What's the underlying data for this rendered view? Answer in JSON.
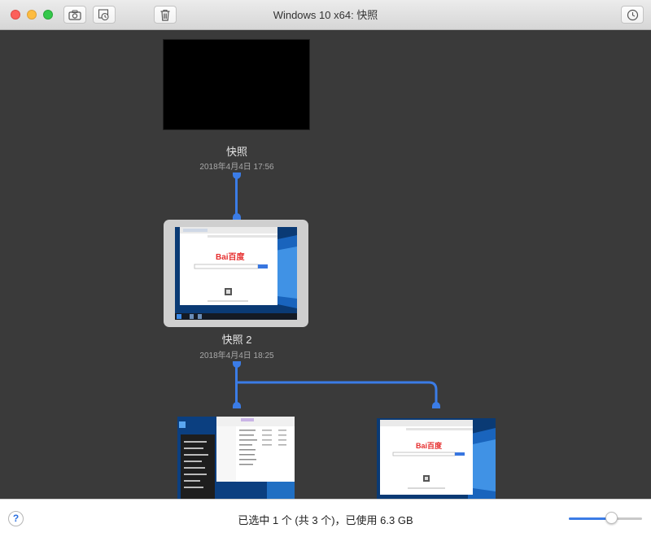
{
  "window": {
    "title": "Windows 10 x64: 快照"
  },
  "toolbar": {
    "take_snapshot_icon": "camera-icon",
    "restore_icon": "restore-snapshot-icon",
    "delete_icon": "trash-icon",
    "auto_protect_icon": "clock-icon"
  },
  "snapshots": [
    {
      "name": "快照",
      "date": "2018年4月4日 17:56"
    },
    {
      "name": "快照 2",
      "date": "2018年4月4日 18:25"
    }
  ],
  "status": {
    "text": "已选中 1 个 (共 3 个)，已使用 6.3 GB",
    "help_label": "?",
    "zoom_level": 0.58
  },
  "thumbnails": {
    "baidu_logo": "Bai百度"
  },
  "colors": {
    "accent": "#3b7ce6",
    "canvas": "#3a3a3a"
  }
}
